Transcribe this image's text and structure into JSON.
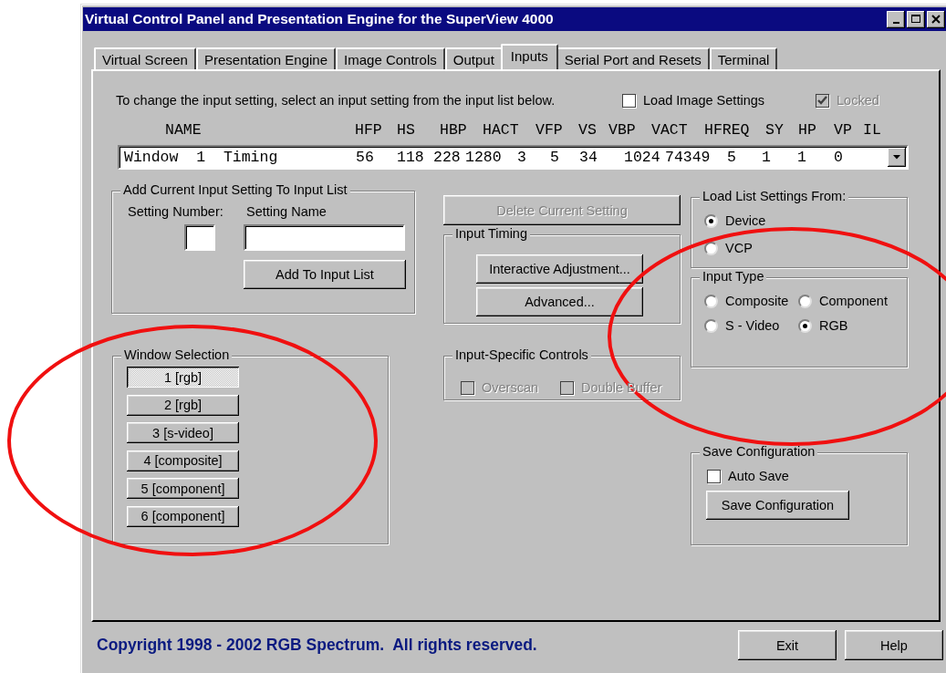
{
  "window": {
    "title": "Virtual Control Panel and Presentation Engine for the SuperView 4000"
  },
  "tabs": [
    {
      "label": "Virtual Screen",
      "selected": false
    },
    {
      "label": "Presentation Engine",
      "selected": false
    },
    {
      "label": "Image Controls",
      "selected": false
    },
    {
      "label": "Output",
      "selected": false
    },
    {
      "label": "Inputs",
      "selected": true
    },
    {
      "label": "Serial Port and Resets",
      "selected": false
    },
    {
      "label": "Terminal",
      "selected": false
    }
  ],
  "instruction": "To change the input setting, select an input setting from the input list below.",
  "options": [
    {
      "label": "Load Image Settings",
      "checked": false,
      "disabled": false
    },
    {
      "label": "Locked",
      "checked": true,
      "disabled": true
    }
  ],
  "input_list": {
    "columns": [
      "NAME",
      "HFP",
      "HS",
      "HBP",
      "HACT",
      "VFP",
      "VS",
      "VBP",
      "VACT",
      "HFREQ",
      "SY",
      "HP",
      "VP",
      "IL"
    ],
    "value": [
      "Window  1  Timing",
      "56",
      "118",
      "228",
      "1280",
      "3",
      "5",
      "34",
      "1024",
      "74349",
      "5",
      "1",
      "1",
      "0"
    ]
  },
  "add_setting": {
    "title": "Add Current Input Setting To Input List",
    "number_label": "Setting Number:",
    "name_label": "Setting Name",
    "button": "Add To Input List"
  },
  "window_selection": {
    "title": "Window Selection",
    "buttons": [
      {
        "label": "1 [rgb]",
        "selected": true
      },
      {
        "label": "2 [rgb]",
        "selected": false
      },
      {
        "label": "3 [s-video]",
        "selected": false
      },
      {
        "label": "4 [composite]",
        "selected": false
      },
      {
        "label": "5 [component]",
        "selected": false
      },
      {
        "label": "6 [component]",
        "selected": false
      }
    ]
  },
  "delete_button": {
    "label": "Delete Current Setting",
    "disabled": true
  },
  "input_timing": {
    "title": "Input Timing",
    "buttons": [
      "Interactive Adjustment...",
      "Advanced..."
    ]
  },
  "input_specific": {
    "title": "Input-Specific Controls",
    "options": [
      {
        "label": "Overscan",
        "checked": false,
        "disabled": true
      },
      {
        "label": "Double Buffer",
        "checked": false,
        "disabled": true
      }
    ]
  },
  "load_from": {
    "title": "Load List Settings From:",
    "options": [
      {
        "label": "Device",
        "selected": true
      },
      {
        "label": "VCP",
        "selected": false
      }
    ]
  },
  "input_type": {
    "title": "Input Type",
    "options": [
      {
        "label": "Composite",
        "selected": false
      },
      {
        "label": "Component",
        "selected": false
      },
      {
        "label": "S - Video",
        "selected": false
      },
      {
        "label": "RGB",
        "selected": true
      }
    ]
  },
  "save_configuration": {
    "title": "Save Configuration",
    "auto_save": {
      "label": "Auto Save",
      "checked": false
    },
    "button": "Save Configuration"
  },
  "copyright": "Copyright 1998 - 2002 RGB Spectrum.  All rights reserved.",
  "buttons": [
    "Exit",
    "Help"
  ],
  "annotations": [
    {
      "kind": "ellipse"
    },
    {
      "kind": "ellipse"
    }
  ]
}
